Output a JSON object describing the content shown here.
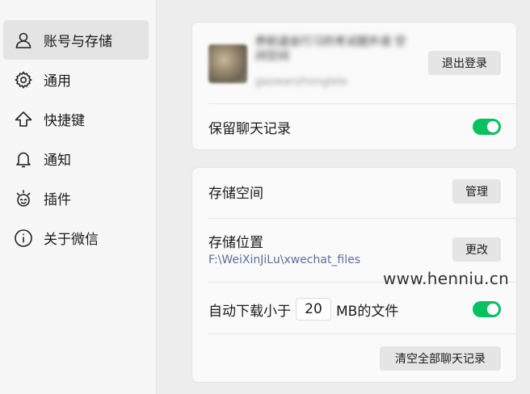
{
  "sidebar": {
    "items": [
      {
        "label": "账号与存储",
        "icon": "user-icon",
        "active": true
      },
      {
        "label": "通用",
        "icon": "gear-icon"
      },
      {
        "label": "快捷键",
        "icon": "arrow-up-icon"
      },
      {
        "label": "通知",
        "icon": "bell-icon"
      },
      {
        "label": "插件",
        "icon": "plugin-icon"
      },
      {
        "label": "关于微信",
        "icon": "info-icon"
      }
    ]
  },
  "account": {
    "name": "养航道会行习的考试题外语 空间空间",
    "id": "gaowanzhonglele",
    "logout_label": "退出登录",
    "keep_history_label": "保留聊天记录",
    "keep_history_on": true
  },
  "storage": {
    "space_label": "存储空间",
    "manage_label": "管理",
    "location_label": "存储位置",
    "location_path": "F:\\WeiXinJiLu\\xwechat_files",
    "change_label": "更改",
    "auto_download_prefix": "自动下载小于",
    "auto_download_value": "20",
    "auto_download_suffix": "MB的文件",
    "auto_download_on": true,
    "clear_all_label": "清空全部聊天记录"
  },
  "watermark": "www.henniu.cn",
  "colors": {
    "accent": "#07c160",
    "link": "#5a6f9a"
  }
}
